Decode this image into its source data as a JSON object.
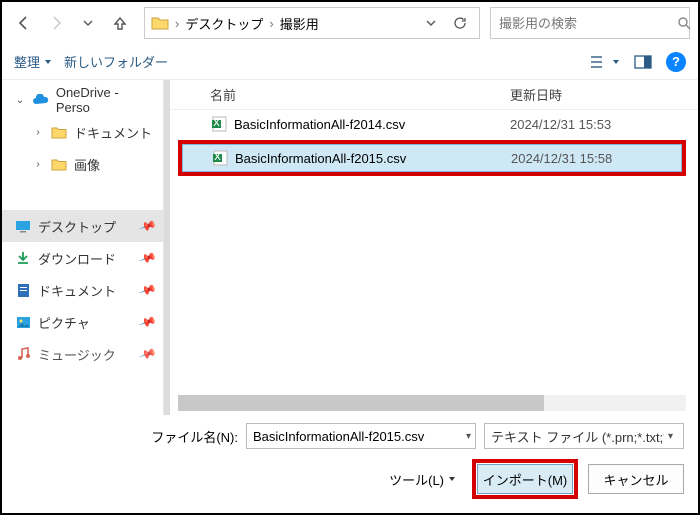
{
  "nav": {
    "breadcrumb": [
      "デスクトップ",
      "撮影用"
    ]
  },
  "search": {
    "placeholder": "撮影用の検索"
  },
  "toolbar": {
    "organize": "整理",
    "newFolder": "新しいフォルダー"
  },
  "sidebar": {
    "onedrive": "OneDrive - Perso",
    "items": [
      {
        "label": "ドキュメント"
      },
      {
        "label": "画像"
      }
    ],
    "quick": [
      {
        "label": "デスクトップ",
        "selected": true
      },
      {
        "label": "ダウンロード"
      },
      {
        "label": "ドキュメント"
      },
      {
        "label": "ピクチャ"
      },
      {
        "label": "ミュージック"
      }
    ]
  },
  "columns": {
    "name": "名前",
    "date": "更新日時"
  },
  "files": [
    {
      "name": "BasicInformationAll-f2014.csv",
      "date": "2024/12/31 15:53",
      "selected": false
    },
    {
      "name": "BasicInformationAll-f2015.csv",
      "date": "2024/12/31 15:58",
      "selected": true
    }
  ],
  "bottom": {
    "fileLabel": "ファイル名(N):",
    "fileName": "BasicInformationAll-f2015.csv",
    "filter": "テキスト ファイル (*.prn;*.txt;*.csv)",
    "tools": "ツール(L)",
    "open": "インポート(M)",
    "cancel": "キャンセル"
  }
}
